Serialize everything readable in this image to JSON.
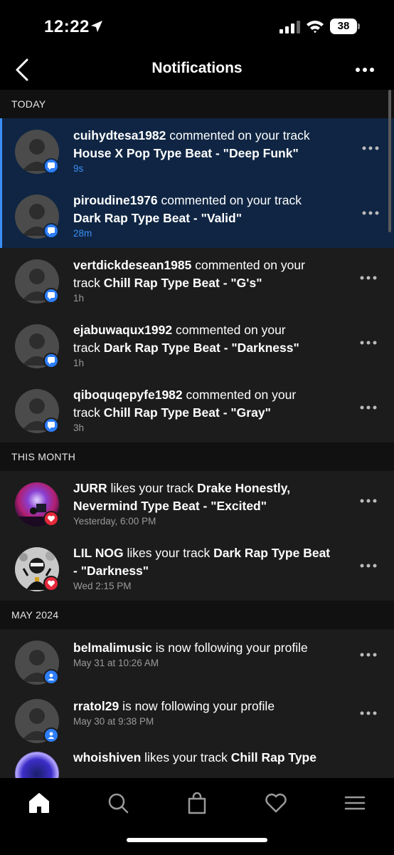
{
  "status": {
    "time": "12:22",
    "battery": "38"
  },
  "header": {
    "title": "Notifications"
  },
  "sections": {
    "today": "TODAY",
    "this_month": "THIS MONTH",
    "may_2024": "MAY 2024"
  },
  "notifications": [
    {
      "user": "cuihydtesa1982",
      "action": " commented on your track",
      "pre": "",
      "track": "House X Pop Type Beat - \"Deep Funk\"",
      "time": "9s",
      "unread": true,
      "type": "comment"
    },
    {
      "user": "piroudine1976",
      "action": " commented on your track",
      "pre": "",
      "track": "Dark Rap Type Beat - \"Valid\"",
      "time": "28m",
      "unread": true,
      "type": "comment"
    },
    {
      "user": "vertdickdesean1985",
      "action": " commented on your",
      "pre": "track ",
      "track": "Chill Rap Type Beat - \"G's\"",
      "time": "1h",
      "unread": false,
      "type": "comment"
    },
    {
      "user": "ejabuwaqux1992",
      "action": " commented on your",
      "pre": "track ",
      "track": "Dark Rap Type Beat - \"Darkness\"",
      "time": "1h",
      "unread": false,
      "type": "comment"
    },
    {
      "user": "qiboquqepyfe1982",
      "action": " commented on your",
      "pre": "track ",
      "track": "Chill Rap Type Beat - \"Gray\"",
      "time": "3h",
      "unread": false,
      "type": "comment"
    },
    {
      "user": "JURR",
      "action": " likes your track ",
      "track_line1": "Drake Honestly,",
      "track_line2": "Nevermind Type Beat - \"Excited\"",
      "time": "Yesterday, 6:00 PM",
      "type": "like"
    },
    {
      "user": "LIL NOG",
      "action": " likes your track ",
      "track_line1": "Dark Rap Type Beat",
      "track_line2": "- \"Darkness\"",
      "time": "Wed 2:15 PM",
      "type": "like"
    },
    {
      "user": "belmalimusic",
      "action": " is now following your profile",
      "time": "May 31 at 10:26 AM",
      "type": "follow"
    },
    {
      "user": "rratol29",
      "action": " is now following your profile",
      "time": "May 30 at 9:38 PM",
      "type": "follow"
    },
    {
      "user": "whoishiven",
      "action": " likes your track ",
      "track_line1": "Chill Rap Type",
      "type": "like"
    }
  ],
  "tabs": [
    "home",
    "search",
    "shop",
    "favorites",
    "menu"
  ],
  "icons": {
    "back": "chevron-left-icon",
    "more": "more-dots-icon",
    "comment_badge": "chat-bubble-icon",
    "like_badge": "heart-icon",
    "follow_badge": "person-icon"
  },
  "colors": {
    "accent": "#2d7ef7",
    "unread_bg": "#0f2543",
    "like": "#e5293b",
    "row_bg": "#1c1c1c"
  }
}
